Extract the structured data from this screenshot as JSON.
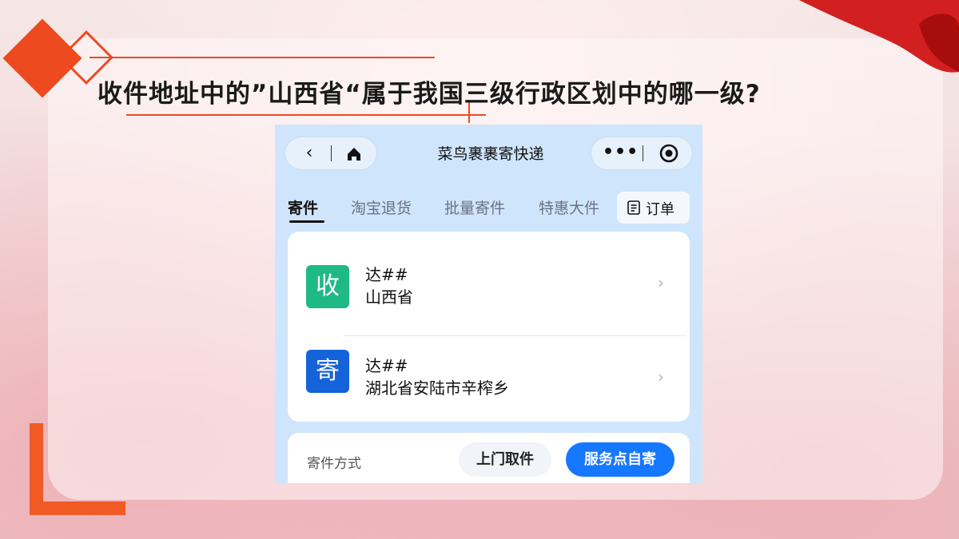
{
  "question": "收件地址中的”山西省“属于我国三级行政区划中的哪一级?",
  "app": {
    "title": "菜鸟裹裹寄快递",
    "more_label": "•••"
  },
  "tabs": [
    {
      "label": "寄件",
      "active": true
    },
    {
      "label": "淘宝退货",
      "active": false
    },
    {
      "label": "批量寄件",
      "active": false
    },
    {
      "label": "特惠大件",
      "active": false
    }
  ],
  "order_label": "订单",
  "recipient": {
    "badge": "收",
    "badge_color": "#1fb985",
    "name": "达##",
    "address": "山西省"
  },
  "sender": {
    "badge": "寄",
    "badge_color": "#1463d9",
    "name": "达##",
    "address": "湖北省安陆市辛榨乡"
  },
  "shipping": {
    "label": "寄件方式",
    "pickup_label": "上门取件",
    "self_label": "服务点自寄"
  },
  "colors": {
    "accent": "#ee4a1f",
    "primary_button": "#1677ff"
  }
}
